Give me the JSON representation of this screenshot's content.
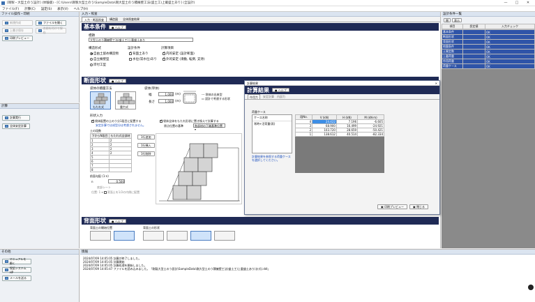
{
  "window": {
    "title": "[剛製・大型土のう設計] (体験版) - [C:\\Users\\剛製大型土のう\\SampleData\\剛大型土のう積擁壁工法(盛土工)上載盛土あり] (全設計)",
    "min": "—",
    "max": "□",
    "close": "✕"
  },
  "menu": [
    "ファイル(F)",
    "計算(C)",
    "設定(S)",
    "表示(V)",
    "ヘルプ(H)"
  ],
  "left_panel": {
    "file_header": "ファイル操作・印刷",
    "buttons": [
      {
        "label": "新規作成",
        "enabled": false
      },
      {
        "label": "ファイルを開く",
        "enabled": true
      },
      {
        "label": "上書き保存",
        "enabled": false
      },
      {
        "label": "名前を付けて保存",
        "enabled": false
      },
      {
        "label": "印刷プレビュー",
        "enabled": true
      }
    ],
    "calc_header": "計算",
    "calc_buttons": [
      "計算実行",
      "全体安定計算"
    ],
    "other_header": "その他",
    "other_buttons": [
      "マニュアルを開く",
      "保証システムHP",
      "メールを送る"
    ]
  },
  "center": {
    "header": "入力・照査",
    "tabs": [
      "入力・断面照査",
      "構造図",
      "全体照査結果"
    ],
    "basic": {
      "title": "基本条件",
      "help": "ヘルプ",
      "project_label": "標題",
      "project_value": "大型土のう積擁壁工法(盛土工)上載盛土あり",
      "structure_label": "構造形式",
      "structures": [
        "自由土留め構造物",
        "自立擁壁型",
        "岸付工型"
      ],
      "design_label": "設計条件",
      "design_items": [
        "背面土あり",
        "水位(常水位)あり"
      ],
      "check_label": "計算項目",
      "check_items": [
        "内的安定 (設計断面)",
        "外的安定 (滑動, 転倒, 支持)"
      ]
    },
    "section": {
      "title": "断面形状",
      "help": "ヘルプ",
      "stack_label": "袋体の積層方法",
      "stack_options": [
        "もたれ式",
        "重力式"
      ],
      "size_label": "袋体(単体)",
      "width_label": "幅",
      "width_value": "1.000",
      "length_label": "長さ",
      "length_value": "1.000",
      "unit": "(m)",
      "legend1": "袋体の出来型",
      "legend2": "設計で考慮する形状",
      "shape_label": "形状入力",
      "opt1": "袋体配置の土のう分1段目に配置する",
      "opt1_note": "安定計算では成型分は考慮されません。",
      "opt2": "袋体全体をもたれ形状に置き換えて計算する",
      "origin_label": "原点位置の基準",
      "origin_value": "各部材の下端基準位置",
      "rows_label": "土の段数",
      "col_headers": [
        "下からN段目",
        "もたれ式全部材"
      ],
      "rows": [
        [
          "1",
          "2"
        ],
        [
          "2",
          "2"
        ],
        [
          "3",
          "2"
        ],
        [
          "4",
          "2"
        ],
        [
          "5",
          ""
        ],
        [
          "6",
          ""
        ],
        [
          "7",
          ""
        ],
        [
          "8",
          ""
        ]
      ],
      "row_buttons": [
        "1行追加",
        "1行挿入",
        "1行削除"
      ],
      "slope_label": "前面勾配 (1:n)",
      "slope_value": "0.500",
      "toe_label": "底部シート",
      "toe_value": "位置: 1 ",
      "toe_note": "背面土を1/2の内側に配置"
    },
    "back": {
      "title": "背面形状",
      "help": "ヘルプ",
      "label1": "背面土の開始位置",
      "label2": "背面土の形状"
    }
  },
  "dialog": {
    "title": "計算結果",
    "heading": "計算結果",
    "help": "ヘルプ",
    "tabs": [
      "作用力",
      "安定計算",
      "内部力"
    ],
    "case_label": "荷重ケース",
    "cases": [
      "ケース名称",
      "常時+活荷重(雨)"
    ],
    "note": "計算結果を参照する荷重ケースを選択してください。",
    "columns": [
      "段No.",
      "V (kN)",
      "H (kN)",
      "M (kN·m)"
    ],
    "rows": [
      [
        "4",
        "24.422",
        "7.196",
        "-6.605"
      ],
      [
        "3",
        "68.900",
        "16.499",
        "-24.921"
      ],
      [
        "2",
        "103.720",
        "28.659",
        "-50.421"
      ],
      [
        "1",
        "138.612",
        "40.514",
        "-82.334"
      ]
    ],
    "preview_btn": "印刷プレビュー",
    "close_btn": "閉じる"
  },
  "right_panel": {
    "header": "設計条件一覧",
    "tabs": [
      "閉",
      "表示"
    ],
    "columns": [
      "項目",
      "設定値",
      "入力チェック"
    ],
    "items": [
      [
        "基本条件",
        "",
        "OK"
      ],
      [
        "断面形状",
        "",
        "OK"
      ],
      [
        "背面形状",
        "",
        "OK"
      ],
      [
        "地盤条件",
        "",
        "OK"
      ],
      [
        "土質定数",
        "",
        "OK"
      ],
      [
        "上載荷重",
        "",
        "OK"
      ],
      [
        "作用荷重",
        "",
        "OK"
      ],
      [
        "荷重ケース",
        "",
        "OK"
      ]
    ]
  },
  "log": {
    "header": "情報",
    "lines": [
      "2024/07/09 14:05:05 計算が終了しました。",
      "2024/07/09 14:05:05 計算開始",
      "2024/07/09 14:05:05 計算処理を開始しました。",
      "2024/07/09 14:05:47 ファイルを読み込みました。「剛製大型土のう設計\\SampleData\\剛大型土のう積擁壁工法(盛土工)上載盛土あり(お式).ddl」"
    ]
  },
  "colors": {
    "navy": "#1f2a55",
    "accent": "#3a6fb0",
    "selected_cell": "#3d8ee6"
  }
}
